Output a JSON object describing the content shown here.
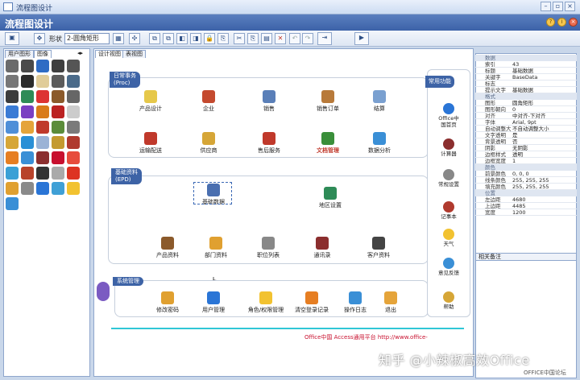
{
  "window": {
    "title": "流程图设计"
  },
  "form": {
    "header_title": "流程图设计"
  },
  "toolbar": {
    "shape_label": "形状",
    "shape_value": "2-圆角矩形"
  },
  "left_tabs": [
    "用户图形",
    "图像"
  ],
  "canvas_tabs": [
    "设计视图",
    "表视图"
  ],
  "sections": [
    {
      "title": "日常事务",
      "code": "(Proc)"
    },
    {
      "title": "基础资料",
      "code": "(EPD)"
    },
    {
      "title": "系统管理",
      "code": ""
    }
  ],
  "proc_nodes": [
    "产品设计",
    "企业",
    "销售",
    "销售订单",
    "结算",
    "运输配送",
    "供应商",
    "售后服务",
    "文档管理",
    "数据分析"
  ],
  "epd_nodes": [
    "基础数据",
    "地区设置",
    "产品资料",
    "部门资料",
    "职位列表",
    "通讯录",
    "客户资料"
  ],
  "sys_nodes": [
    "修改密码",
    "用户管理",
    "角色/权限管理",
    "清空登录记录",
    "操作日志",
    "退出"
  ],
  "common_title": "常用功能",
  "common_items": [
    "Office中国首页",
    "计算器",
    "常规设置",
    "记事本",
    "天气",
    "意见反馈",
    "帮助"
  ],
  "footer_text": "Office中国 Access通用平台 http://www.office-",
  "properties": {
    "group1": "数据",
    "rows1": [
      [
        "索引",
        "43"
      ],
      [
        "标题",
        "基础数据"
      ],
      [
        "关键字",
        "BaseData"
      ],
      [
        "标志",
        ""
      ],
      [
        "提示文字",
        "基础数据"
      ]
    ],
    "group2": "格式",
    "rows2": [
      [
        "图形",
        "圆角矩形"
      ],
      [
        "图形朝向",
        "0"
      ],
      [
        "对齐",
        "中对齐-下对齐"
      ],
      [
        "字体",
        "Arial, 9pt"
      ],
      [
        "自动调整大",
        "不自动调整大小"
      ],
      [
        "文字透明",
        "是"
      ],
      [
        "背景透明",
        "否"
      ],
      [
        "阴影",
        "无阴影"
      ],
      [
        "边框样式",
        "透明"
      ],
      [
        "边框宽度",
        "1"
      ]
    ],
    "group3": "颜色",
    "rows3": [
      [
        "前景颜色",
        "0, 0, 0"
      ],
      [
        "线条颜色",
        "255, 255, 255"
      ],
      [
        "填充颜色",
        "255, 255, 255"
      ]
    ],
    "group4": "位置",
    "rows4": [
      [
        "左边距",
        "4680"
      ],
      [
        "上边距",
        "4485"
      ],
      [
        "宽度",
        "1200"
      ]
    ]
  },
  "notes_title": "相关备注",
  "watermark": {
    "zh": "知乎 @小辣椒高效Office",
    "site": "OFFICE中国论坛"
  }
}
